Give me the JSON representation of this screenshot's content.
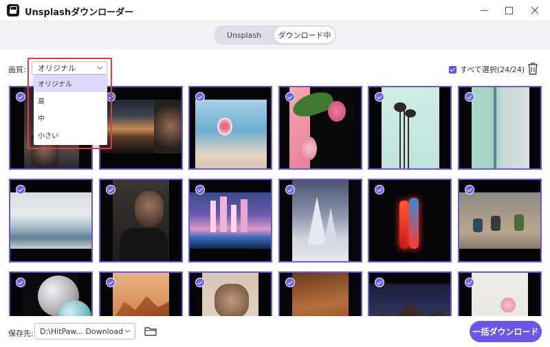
{
  "window": {
    "title": "Unsplashダウンローダー"
  },
  "tabs": [
    {
      "label": "Unsplash"
    },
    {
      "label": "ダウンロード中"
    }
  ],
  "toolbar": {
    "quality_label": "画質:",
    "quality_value": "オリジナル",
    "select_all_label": "すべて選択(24/24)"
  },
  "quality_dropdown": {
    "options": [
      {
        "label": "オリジナル",
        "selected": true
      },
      {
        "label": "高",
        "selected": false
      },
      {
        "label": "中",
        "selected": false
      },
      {
        "label": "小さい",
        "selected": false
      }
    ]
  },
  "grid": {
    "tiles": [
      {
        "subject": "person at dusk",
        "checked": true
      },
      {
        "subject": "sunset mountains and person",
        "checked": true
      },
      {
        "subject": "hand mirror at beach",
        "checked": true
      },
      {
        "subject": "pink flowers",
        "checked": true
      },
      {
        "subject": "palm trees",
        "checked": true
      },
      {
        "subject": "aerial road",
        "checked": true
      },
      {
        "subject": "sea shore",
        "checked": true
      },
      {
        "subject": "man portrait",
        "checked": true
      },
      {
        "subject": "city skyline at night",
        "checked": true
      },
      {
        "subject": "snowy forest",
        "checked": true
      },
      {
        "subject": "neon figures",
        "checked": true
      },
      {
        "subject": "hikers on rocks",
        "checked": true
      },
      {
        "subject": "abstract spheres",
        "checked": true
      },
      {
        "subject": "desert rocks",
        "checked": true
      },
      {
        "subject": "tattooed hand",
        "checked": true
      },
      {
        "subject": "sand dunes",
        "checked": true
      },
      {
        "subject": "mountain night sky",
        "checked": true
      },
      {
        "subject": "pink blossoms",
        "checked": true
      }
    ]
  },
  "footer": {
    "save_label": "保存先:",
    "path_value": "D:\\HitPaw... Download",
    "download_all_label": "一括ダウンロード"
  },
  "colors": {
    "accent": "#6b57e6",
    "tile_border": "#6b5ad9",
    "highlight": "#e23c3c"
  },
  "icons": [
    "app-logo-icon",
    "minimize-icon",
    "maximize-icon",
    "close-icon",
    "chevron-down-icon",
    "trash-icon",
    "folder-icon",
    "check-icon"
  ]
}
